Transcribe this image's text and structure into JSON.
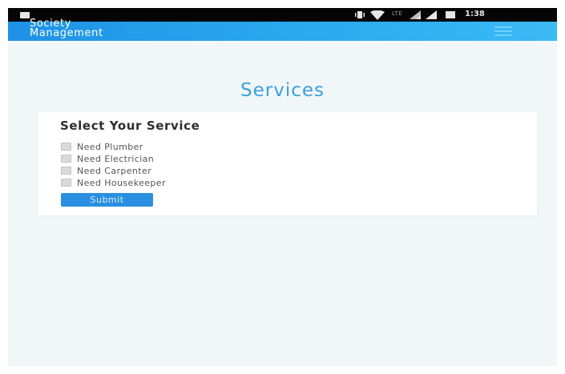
{
  "status_bar": {
    "network_label": "LTE",
    "time": "1:38",
    "icons": [
      "notification-icon",
      "vibrate-icon",
      "wifi-icon",
      "signal-icon",
      "signal-icon",
      "battery-icon"
    ]
  },
  "app_bar": {
    "title_line1": "Society",
    "title_line2": "Management",
    "menu_icon": "hamburger-menu-icon",
    "color_start": "#1e92e6",
    "color_end": "#3bbaf4"
  },
  "page": {
    "title": "Services",
    "title_color": "#3aa0dc"
  },
  "service_form": {
    "heading": "Select Your Service",
    "options": [
      {
        "label": "Need Plumber",
        "checked": false
      },
      {
        "label": "Need Electrician",
        "checked": false
      },
      {
        "label": "Need Carpenter",
        "checked": false
      },
      {
        "label": "Need Housekeeper",
        "checked": false
      }
    ],
    "submit_label": "Submit",
    "submit_color": "#2a8fe0"
  }
}
